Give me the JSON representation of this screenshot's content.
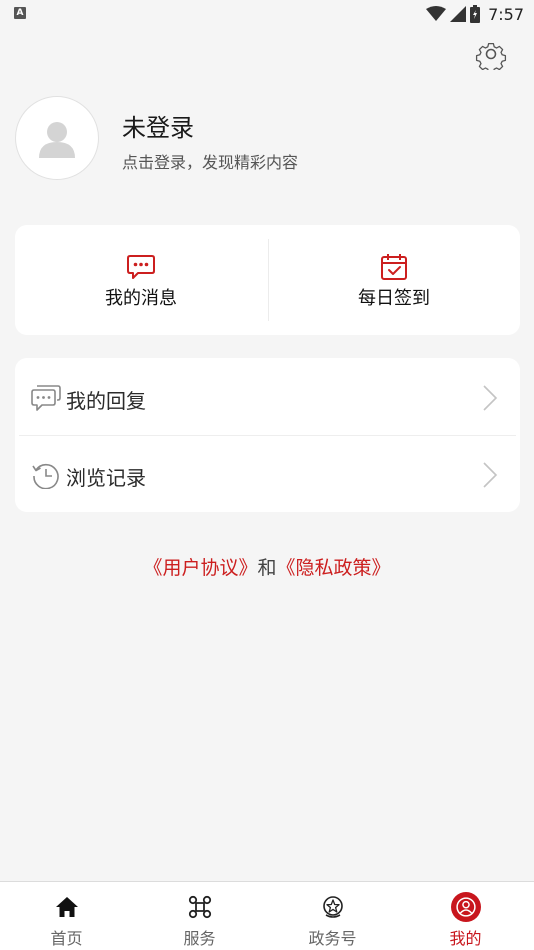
{
  "status_bar": {
    "notification_icon": "A",
    "time": "7:57"
  },
  "profile": {
    "name": "未登录",
    "subtitle": "点击登录，发现精彩内容"
  },
  "quick_actions": [
    {
      "label": "我的消息",
      "icon": "message-icon"
    },
    {
      "label": "每日签到",
      "icon": "calendar-check-icon"
    }
  ],
  "menu": [
    {
      "label": "我的回复",
      "icon": "comments-icon"
    },
    {
      "label": "浏览记录",
      "icon": "history-icon"
    }
  ],
  "agreement": {
    "user_agreement": "《用户协议》",
    "conjunction": "和",
    "privacy_policy": "《隐私政策》"
  },
  "tabs": [
    {
      "label": "首页",
      "icon": "home-icon",
      "active": false
    },
    {
      "label": "服务",
      "icon": "services-icon",
      "active": false
    },
    {
      "label": "政务号",
      "icon": "gov-account-icon",
      "active": false
    },
    {
      "label": "我的",
      "icon": "profile-icon",
      "active": true
    }
  ],
  "colors": {
    "accent": "#c8161d",
    "background": "#f5f5f5"
  }
}
